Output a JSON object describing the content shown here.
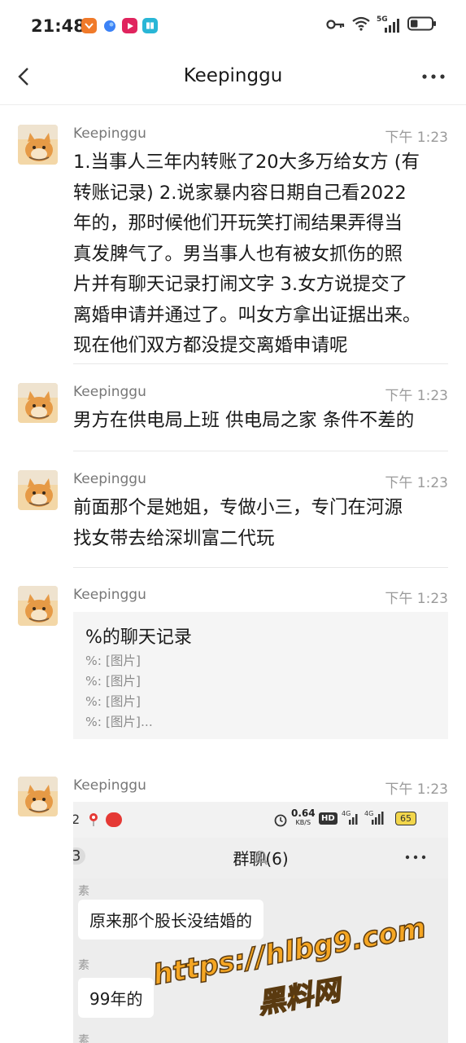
{
  "status_bar": {
    "time": "21:48",
    "network_label": "5G",
    "battery_level": 0.35
  },
  "nav": {
    "title": "Keepinggu"
  },
  "messages": [
    {
      "sender": "Keepinggu",
      "time": "下午 1:23",
      "lines": [
        "1.当事人三年内转账了20大多万给女方 (有",
        "转账记录) 2.说家暴内容日期自己看2022",
        "年的，那时候他们开玩笑打闹结果弄得当",
        "真发脾气了。男当事人也有被女抓伤的照",
        "片并有聊天记录打闹文字 3.女方说提交了",
        "离婚申请并通过了。叫女方拿出证据出来。",
        "现在他们双方都没提交离婚申请呢"
      ]
    },
    {
      "sender": "Keepinggu",
      "time": "下午 1:23",
      "lines": [
        "男方在供电局上班 供电局之家 条件不差的"
      ]
    },
    {
      "sender": "Keepinggu",
      "time": "下午 1:23",
      "lines": [
        "前面那个是她姐，专做小三，专门在河源",
        "找女带去给深圳富二代玩"
      ]
    },
    {
      "sender": "Keepinggu",
      "time": "下午 1:23",
      "forward": {
        "title": "%的聊天记录",
        "lines": [
          "%: [图片]",
          "%: [图片]",
          "%: [图片]",
          "%: [图片]..."
        ]
      }
    },
    {
      "sender": "Keepinggu",
      "time": "下午 1:23",
      "screenshot": {
        "status_left": "2",
        "speed": "0.64",
        "speed_unit": "KB/S",
        "hd": "HD",
        "net1": "4G",
        "net2": "4G",
        "battery": "65",
        "group_title": "群聊(6)",
        "badge": "3",
        "sender_tag_1": "素",
        "bubble_1": "原来那个股长没结婚的",
        "sender_tag_2": "素",
        "bubble_2": "99年的",
        "sender_tag_3": "素"
      }
    }
  ],
  "watermark": {
    "url": "https://hlbg9.com",
    "name": "黑料网"
  },
  "colors": {
    "divider": "#e8e8e8",
    "card_bg": "#f5f5f5",
    "watermark": "#f5a623"
  }
}
